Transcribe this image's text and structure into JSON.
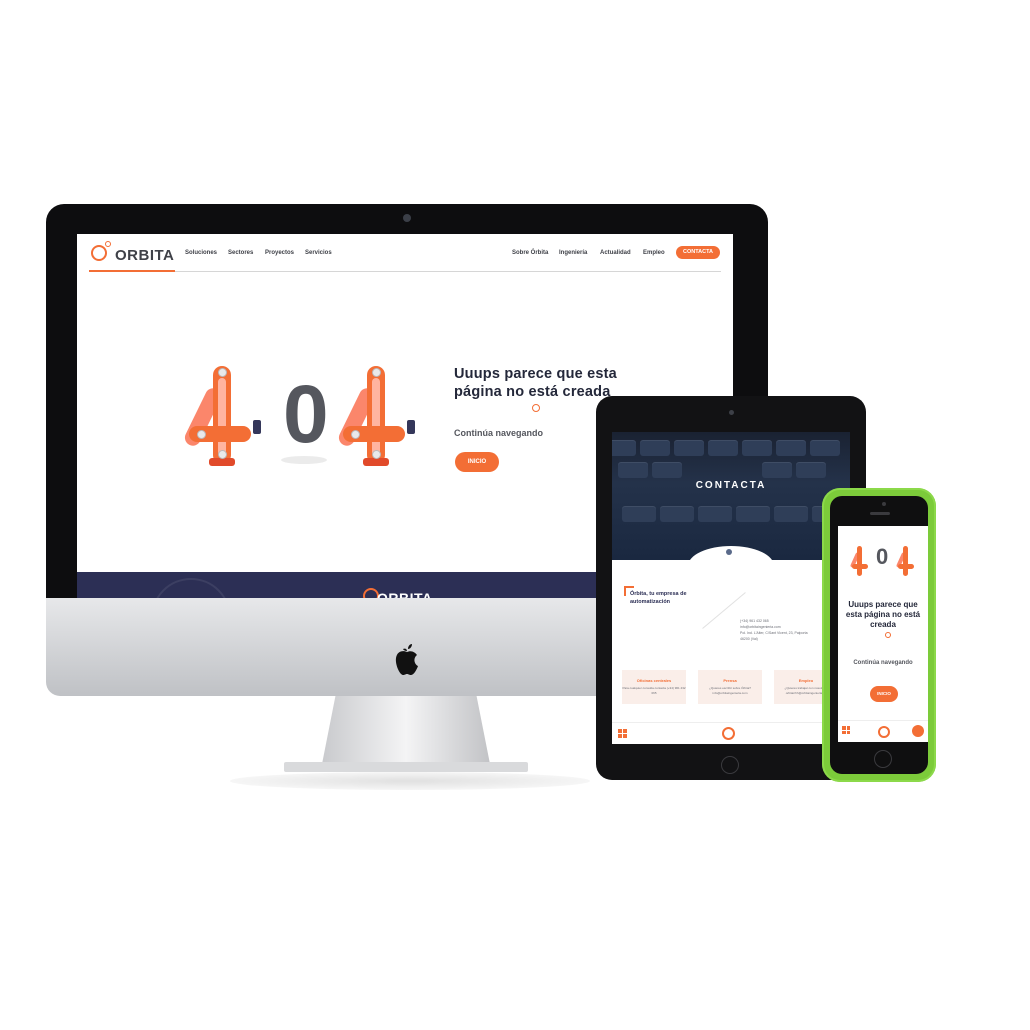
{
  "desktop": {
    "logo_text": "ORBITA",
    "nav_left": [
      "Soluciones",
      "Sectores",
      "Proyectos",
      "Servicios"
    ],
    "nav_right": [
      "Sobre Órbita",
      "Ingeniería",
      "Actualidad",
      "Empleo"
    ],
    "cta_label": "CONTACTA",
    "error_code_middle": "0",
    "error_title": "Uuups parece que esta página no está creada",
    "error_subtitle": "Continúa navegando",
    "home_button": "INICIO",
    "footer_logo": "ORBITA"
  },
  "tablet": {
    "hero_title": "CONTACTA",
    "heading": "Órbita, tu empresa de automatización",
    "info_lines": [
      "(+34) 961 432 065",
      "info@orbitaingenieria.com",
      "Pol. Ind. L'Alter, C/Sant Vicent, 23, Paiporta",
      "46200 (Val)"
    ],
    "cards": [
      {
        "title": "Oficinas centrales",
        "text": "Para cualquier consulta contacta (+34) 961 432 065"
      },
      {
        "title": "Prensa",
        "text": "¿Quieres escribir sobre Órbita? info@orbitaingenieria.com"
      },
      {
        "title": "Empleo",
        "text": "¿Quieres trabajar con nosotros? orbitarrhh@orbitaingenieria.es"
      }
    ]
  },
  "phone": {
    "error_code_middle": "0",
    "error_title": "Uuups parece que esta página no está creada",
    "error_subtitle": "Continúa navegando",
    "home_button": "INICIO"
  },
  "colors": {
    "accent": "#f36e35",
    "navy": "#2c2f55",
    "text_dark": "#24283a",
    "phone_case": "#7ccb3a"
  },
  "icons": [
    "orbita-logo-icon",
    "apple-logo-icon",
    "grid-menu-icon",
    "chevron-down-icon"
  ]
}
